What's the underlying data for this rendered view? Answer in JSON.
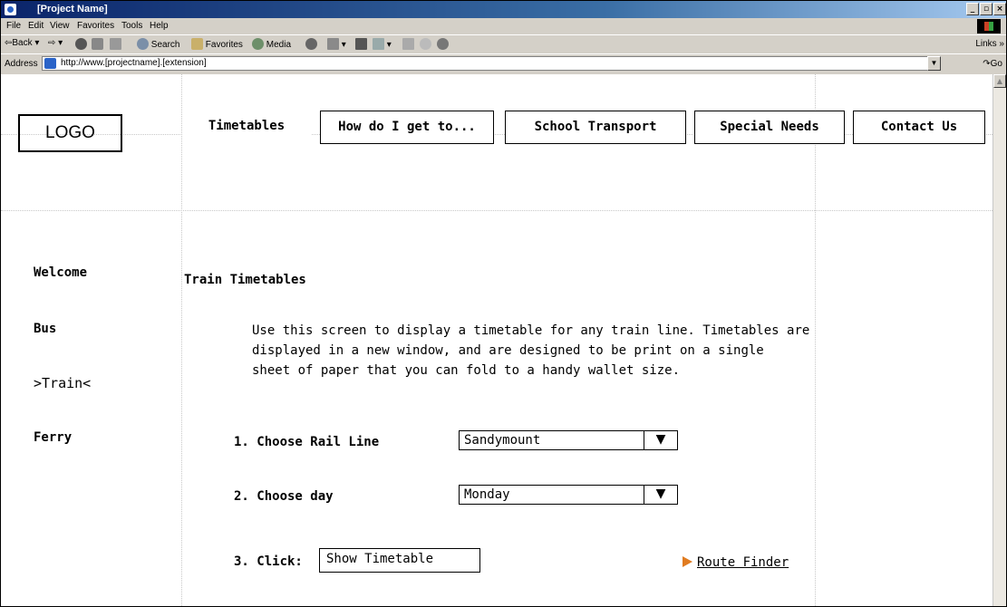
{
  "window": {
    "title": "[Project Name]",
    "buttons": {
      "minimize": "_",
      "maximize": "▫",
      "close": "×"
    }
  },
  "menu": [
    "File",
    "Edit",
    "View",
    "Favorites",
    "Tools",
    "Help"
  ],
  "toolbar": {
    "back": "⇦Back ▾",
    "forward": "⇨ ▾",
    "search": "Search",
    "favorites": "Favorites",
    "media": "Media",
    "links": "Links »"
  },
  "address": {
    "label": "Address",
    "url": "http://www.[projectname].[extension]",
    "go": "Go"
  },
  "logo": "LOGO",
  "nav": [
    "Timetables",
    "How do I get to...",
    "School Transport",
    "Special Needs",
    "Contact Us"
  ],
  "sidebar": [
    "Welcome",
    "Bus",
    ">Train<",
    "Ferry"
  ],
  "main": {
    "title": "Train Timetables",
    "intro": [
      "Use this screen to display a timetable for any train line. Timetables are",
      "displayed in a new window, and are designed to be print on a single",
      "sheet of paper that you can fold to a handy wallet size."
    ],
    "rail_line_label": "1. Choose Rail Line",
    "rail_line_value": "Sandymount",
    "day_label": "2. Choose day",
    "day_value": "Monday",
    "click_label": "3. Click:",
    "show_button": "Show Timetable",
    "route_finder": "Route Finder"
  }
}
